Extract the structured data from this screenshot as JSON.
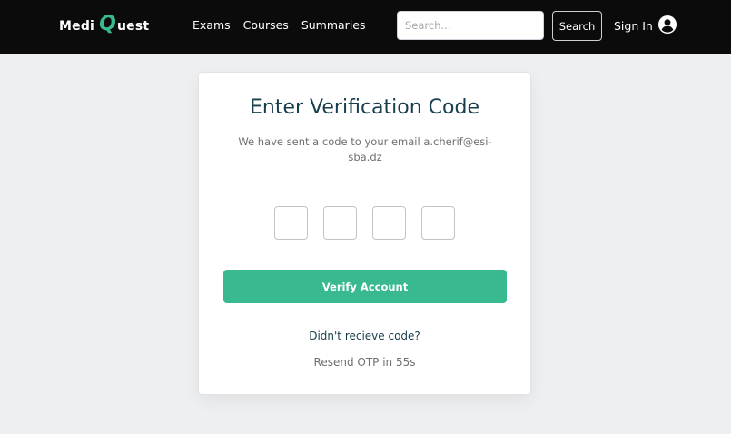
{
  "brand": {
    "name_part1": "Medi",
    "name_q": "Q",
    "name_part2": "uest",
    "accent_color": "#38b98f"
  },
  "nav": {
    "links": [
      "Exams",
      "Courses",
      "Summaries"
    ]
  },
  "search": {
    "placeholder": "Search...",
    "value": "",
    "button_label": "Search"
  },
  "auth": {
    "signin_label": "Sign In",
    "icon": "user-circle-icon"
  },
  "verification": {
    "title": "Enter Verification Code",
    "subtitle": "We have sent a code to your email a.cherif@esi-sba.dz",
    "otp_digits": [
      "",
      "",
      "",
      ""
    ],
    "verify_button_label": "Verify Account",
    "resend_link_label": "Didn't recieve code?",
    "resend_timer_label": "Resend OTP in 55s"
  }
}
